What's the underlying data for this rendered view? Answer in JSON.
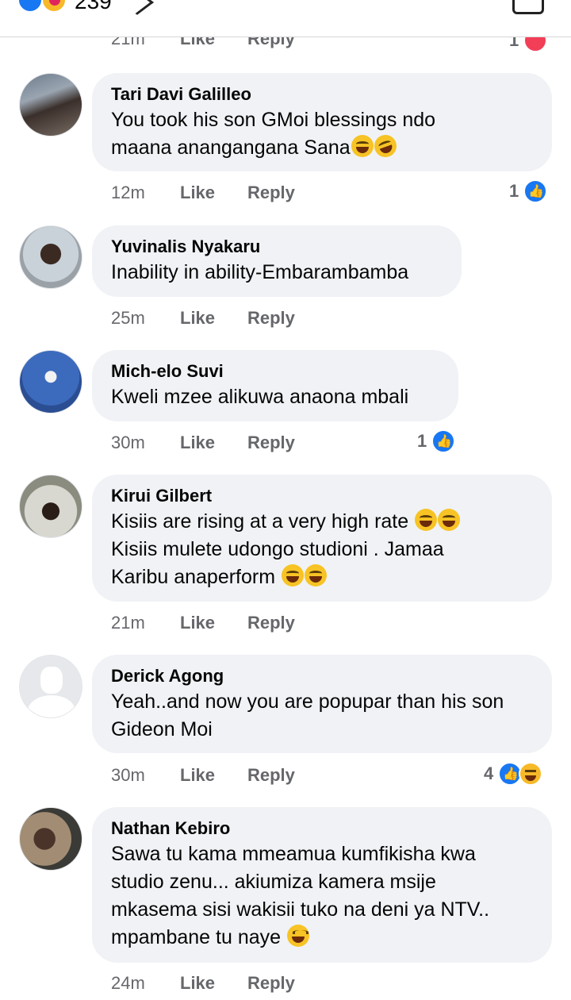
{
  "post_bar": {
    "reaction_count": "239",
    "reactions": [
      "like",
      "haha"
    ]
  },
  "prev_comment_meta": {
    "time": "21m",
    "like": "Like",
    "reply": "Reply",
    "reaction_count": "1",
    "reaction_icon": "love-icon"
  },
  "comments": [
    {
      "name": "Tari Davi Galilleo",
      "text_line1": "You took his son GMoi blessings ndo",
      "text_line2": "maana anangangana Sana",
      "time": "12m",
      "like": "Like",
      "reply": "Reply",
      "reaction_count": "1",
      "reactions": [
        "like"
      ]
    },
    {
      "name": "Yuvinalis Nyakaru",
      "text_line1": "Inability in ability-Embarambamba",
      "time": "25m",
      "like": "Like",
      "reply": "Reply"
    },
    {
      "name": "Mich-elo Suvi",
      "text_line1": "Kweli mzee alikuwa anaona mbali",
      "time": "30m",
      "like": "Like",
      "reply": "Reply",
      "reaction_count": "1",
      "reactions": [
        "like"
      ]
    },
    {
      "name": "Kirui Gilbert",
      "text_line1": "Kisiis are rising at a very high rate",
      "text_line2": "Kisiis mulete udongo studioni . Jamaa",
      "text_line3": "Karibu anaperform",
      "time": "21m",
      "like": "Like",
      "reply": "Reply"
    },
    {
      "name": "Derick Agong",
      "text_line1": "Yeah..and now you are popupar than his son",
      "text_line2": "Gideon Moi",
      "time": "30m",
      "like": "Like",
      "reply": "Reply",
      "reaction_count": "4",
      "reactions": [
        "like",
        "haha"
      ]
    },
    {
      "name": "Nathan Kebiro",
      "text_line1": "Sawa tu kama mmeamua kumfikisha kwa",
      "text_line2": "studio zenu... akiumiza kamera msije",
      "text_line3": "mkasema sisi wakisii tuko na deni ya NTV..",
      "text_line4": "mpambane tu naye",
      "time": "24m",
      "like": "Like",
      "reply": "Reply"
    }
  ],
  "colors": {
    "bubble_bg": "#f0f2f5",
    "meta_text": "#65676b",
    "like_blue": "#1877f2",
    "haha_yellow": "#f7b928",
    "love_red": "#f33e58"
  }
}
